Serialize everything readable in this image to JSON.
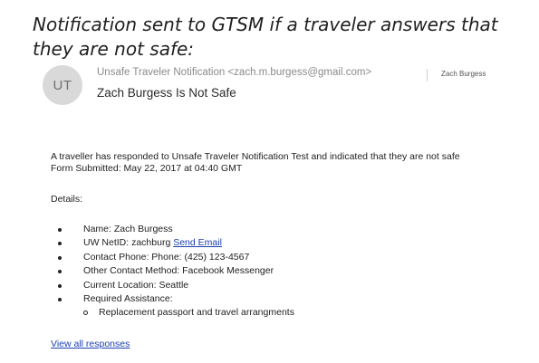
{
  "caption": "Notification sent to GTSM if a traveler answers that they are not safe:",
  "email": {
    "avatar_initials": "UT",
    "from": "Unsafe Traveler Notification <zach.m.burgess@gmail.com>",
    "to": "Zach Burgess",
    "subject": "Zach Burgess Is Not Safe",
    "body_line1": "A traveller has responded to Unsafe Traveler Notification Test and indicated that they are not safe",
    "body_line2": "Form Submitted: May 22, 2017 at 04:40 GMT",
    "details_label": "Details:",
    "items": [
      {
        "text": "Name: Zach Burgess"
      },
      {
        "text": "UW NetID: zachburg ",
        "link": "Send Email"
      },
      {
        "text": "Contact Phone: Phone: (425) 123-4567"
      },
      {
        "text": "Other Contact Method: Facebook Messenger"
      },
      {
        "text": "Current Location: Seattle"
      },
      {
        "text": "Required Assistance:"
      }
    ],
    "sub_items": [
      "Replacement passport and travel arrangments"
    ],
    "view_all_link": "View all responses"
  },
  "colors": {
    "link": "#1a3fb0",
    "avatar_bg": "#d9d9d9"
  }
}
